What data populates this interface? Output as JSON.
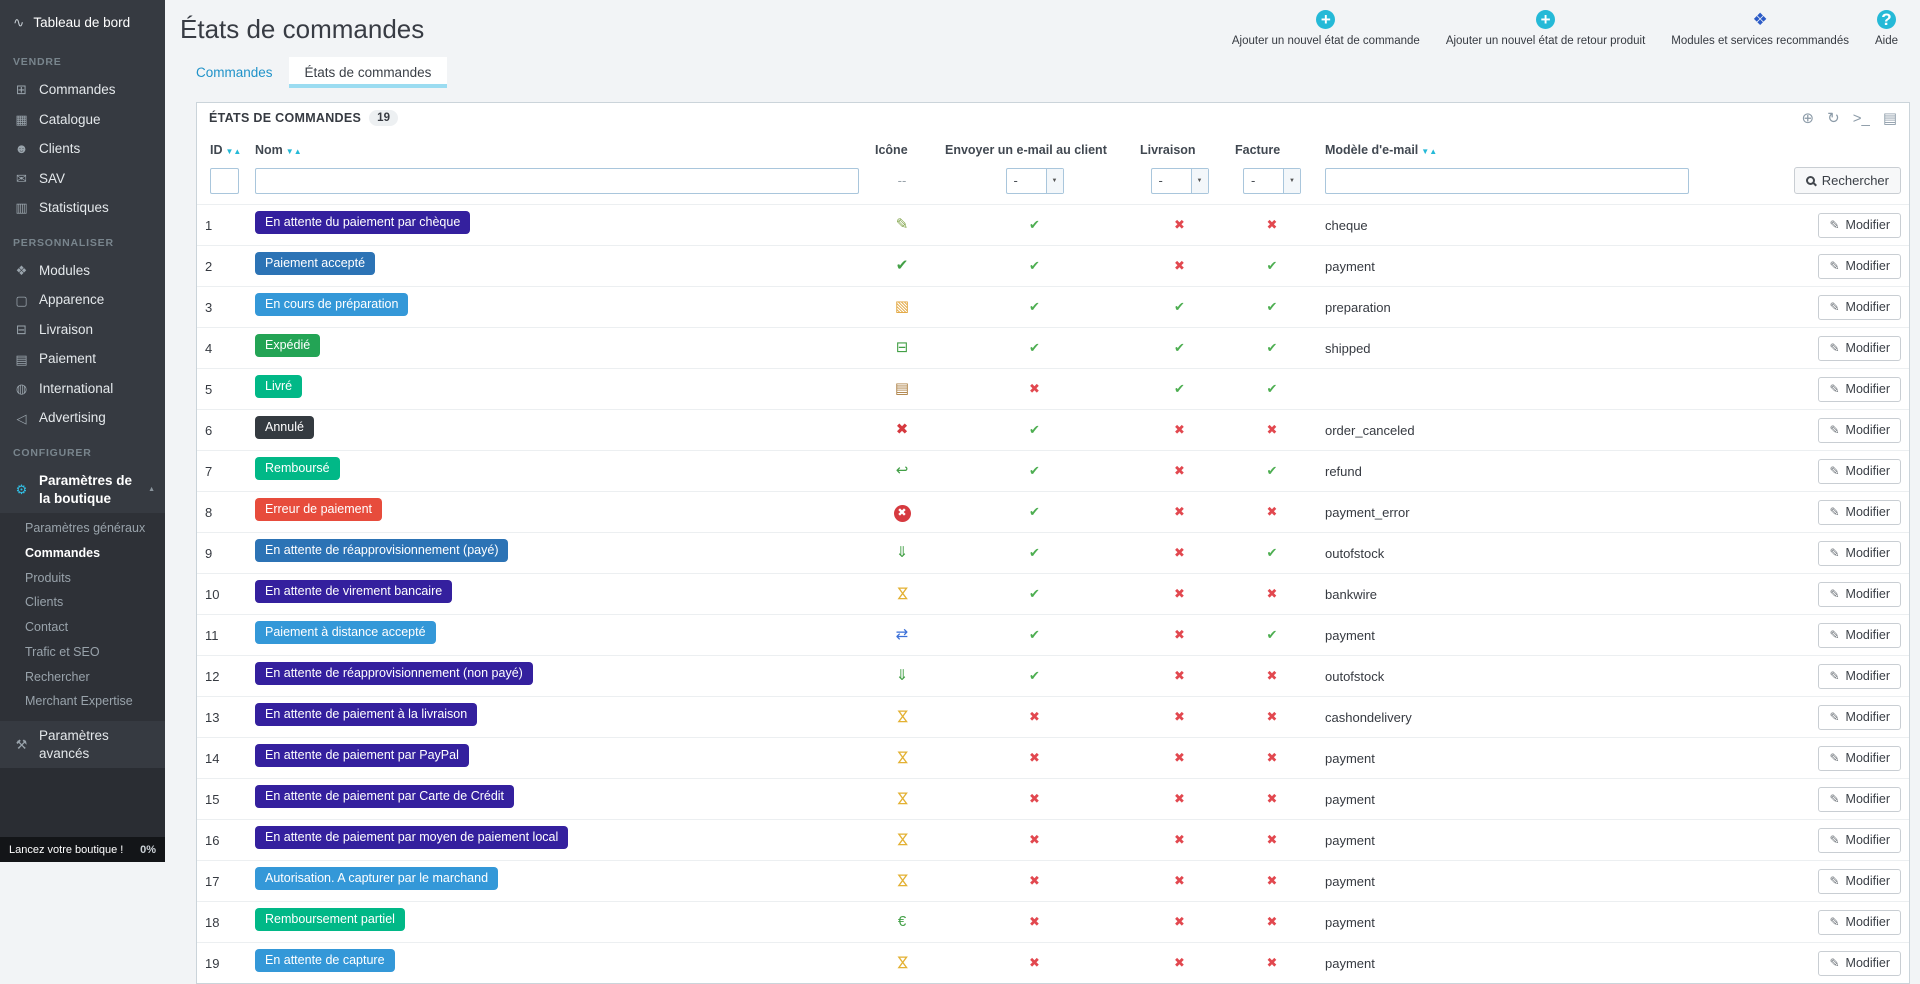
{
  "accent_colors": {
    "primary": "#25B9D7"
  },
  "sidebar": {
    "top_item": {
      "label": "Tableau de bord",
      "icon": "dashboard-icon"
    },
    "sections": [
      {
        "title": "VENDRE",
        "items": [
          {
            "label": "Commandes",
            "icon": "orders-icon"
          },
          {
            "label": "Catalogue",
            "icon": "catalog-icon"
          },
          {
            "label": "Clients",
            "icon": "customers-icon"
          },
          {
            "label": "SAV",
            "icon": "customer-service-icon"
          },
          {
            "label": "Statistiques",
            "icon": "stats-icon"
          }
        ]
      },
      {
        "title": "PERSONNALISER",
        "items": [
          {
            "label": "Modules",
            "icon": "modules-puzzle-icon"
          },
          {
            "label": "Apparence",
            "icon": "appearance-icon"
          },
          {
            "label": "Livraison",
            "icon": "shipping-icon"
          },
          {
            "label": "Paiement",
            "icon": "payment-icon"
          },
          {
            "label": "International",
            "icon": "international-icon"
          },
          {
            "label": "Advertising",
            "icon": "advertising-icon"
          }
        ]
      },
      {
        "title": "CONFIGURER",
        "items": [
          {
            "label": "Paramètres de la boutique",
            "icon": "shop-parameters-icon",
            "active": true,
            "expanded": true,
            "children": [
              {
                "label": "Paramètres généraux"
              },
              {
                "label": "Commandes",
                "active": true
              },
              {
                "label": "Produits"
              },
              {
                "label": "Clients"
              },
              {
                "label": "Contact"
              },
              {
                "label": "Trafic et SEO"
              },
              {
                "label": "Rechercher"
              },
              {
                "label": "Merchant Expertise"
              }
            ]
          },
          {
            "label": "Paramètres avancés",
            "icon": "advanced-parameters-icon"
          }
        ]
      }
    ],
    "footer": {
      "label": "Lancez votre boutique !",
      "progress": "0%"
    }
  },
  "header": {
    "title": "États de commandes",
    "actions": [
      {
        "label": "Ajouter un nouvel état de commande",
        "icon": "plus-circle-icon"
      },
      {
        "label": "Ajouter un nouvel état de retour produit",
        "icon": "plus-circle-icon"
      },
      {
        "label": "Modules et services recommandés",
        "icon": "modules-services-icon"
      },
      {
        "label": "Aide",
        "icon": "help-icon"
      }
    ]
  },
  "tabs": [
    {
      "label": "Commandes",
      "active": false
    },
    {
      "label": "États de commandes",
      "active": true
    }
  ],
  "panel": {
    "title": "ÉTATS DE COMMANDES",
    "count": "19",
    "toolbar": [
      {
        "name": "add-icon"
      },
      {
        "name": "refresh-icon"
      },
      {
        "name": "console-icon"
      },
      {
        "name": "export-icon"
      }
    ]
  },
  "table": {
    "columns": [
      {
        "label": "ID",
        "key": "id",
        "sortable": true,
        "filter": "input"
      },
      {
        "label": "Nom",
        "key": "name",
        "sortable": true,
        "filter": "input"
      },
      {
        "label": "Icône",
        "key": "icon",
        "align": "center",
        "filter": "text"
      },
      {
        "label": "Envoyer un e-mail au client",
        "key": "email",
        "align": "center",
        "filter": "select"
      },
      {
        "label": "Livraison",
        "key": "delivery",
        "align": "center",
        "filter": "select"
      },
      {
        "label": "Facture",
        "key": "invoice",
        "align": "center",
        "filter": "select"
      },
      {
        "label": "Modèle d'e-mail",
        "key": "template",
        "sortable": true,
        "filter": "input"
      },
      {
        "label": "",
        "key": "actions",
        "filter": "search"
      }
    ],
    "filters": {
      "icon_placeholder": "--",
      "select_value": "-",
      "search_button": "Rechercher"
    },
    "edit_label": "Modifier",
    "rows": [
      {
        "id": "1",
        "name": "En attente du paiement par chèque",
        "color": "#34209E",
        "icon": "cheque-icon",
        "email": true,
        "delivery": false,
        "invoice": false,
        "template": "cheque"
      },
      {
        "id": "2",
        "name": "Paiement accepté",
        "color": "#2C73B5",
        "icon": "valid-icon",
        "email": true,
        "delivery": false,
        "invoice": true,
        "template": "payment"
      },
      {
        "id": "3",
        "name": "En cours de préparation",
        "color": "#3498D8",
        "icon": "preparation-icon",
        "email": true,
        "delivery": true,
        "invoice": true,
        "template": "preparation"
      },
      {
        "id": "4",
        "name": "Expédié",
        "color": "#23A455",
        "icon": "truck-icon",
        "email": true,
        "delivery": true,
        "invoice": true,
        "template": "shipped"
      },
      {
        "id": "5",
        "name": "Livré",
        "color": "#01B887",
        "icon": "delivered-icon",
        "email": false,
        "delivery": true,
        "invoice": true,
        "template": ""
      },
      {
        "id": "6",
        "name": "Annulé",
        "color": "#343A40",
        "icon": "canceled-icon",
        "email": true,
        "delivery": false,
        "invoice": false,
        "template": "order_canceled"
      },
      {
        "id": "7",
        "name": "Remboursé",
        "color": "#01B887",
        "icon": "refund-icon",
        "email": true,
        "delivery": false,
        "invoice": true,
        "template": "refund"
      },
      {
        "id": "8",
        "name": "Erreur de paiement",
        "color": "#E74C3C",
        "icon": "payment-error-icon",
        "email": true,
        "delivery": false,
        "invoice": false,
        "template": "payment_error"
      },
      {
        "id": "9",
        "name": "En attente de réapprovisionnement (payé)",
        "color": "#2C73B5",
        "icon": "restock-icon",
        "email": true,
        "delivery": false,
        "invoice": true,
        "template": "outofstock"
      },
      {
        "id": "10",
        "name": "En attente de virement bancaire",
        "color": "#34209E",
        "icon": "waiting-icon",
        "email": true,
        "delivery": false,
        "invoice": false,
        "template": "bankwire"
      },
      {
        "id": "11",
        "name": "Paiement à distance accepté",
        "color": "#3498D8",
        "icon": "remote-payment-icon",
        "email": true,
        "delivery": false,
        "invoice": true,
        "template": "payment"
      },
      {
        "id": "12",
        "name": "En attente de réapprovisionnement (non payé)",
        "color": "#34209E",
        "icon": "restock-icon",
        "email": true,
        "delivery": false,
        "invoice": false,
        "template": "outofstock"
      },
      {
        "id": "13",
        "name": "En attente de paiement à la livraison",
        "color": "#34209E",
        "icon": "waiting-icon",
        "email": false,
        "delivery": false,
        "invoice": false,
        "template": "cashondelivery"
      },
      {
        "id": "14",
        "name": "En attente de paiement par PayPal",
        "color": "#34209E",
        "icon": "waiting-icon",
        "email": false,
        "delivery": false,
        "invoice": false,
        "template": "payment"
      },
      {
        "id": "15",
        "name": "En attente de paiement par Carte de Crédit",
        "color": "#34209E",
        "icon": "waiting-icon",
        "email": false,
        "delivery": false,
        "invoice": false,
        "template": "payment"
      },
      {
        "id": "16",
        "name": "En attente de paiement par moyen de paiement local",
        "color": "#34209E",
        "icon": "waiting-icon",
        "email": false,
        "delivery": false,
        "invoice": false,
        "template": "payment"
      },
      {
        "id": "17",
        "name": "Autorisation. A capturer par le marchand",
        "color": "#3498D8",
        "icon": "waiting-icon",
        "email": false,
        "delivery": false,
        "invoice": false,
        "template": "payment"
      },
      {
        "id": "18",
        "name": "Remboursement partiel",
        "color": "#01B887",
        "icon": "money-icon",
        "email": false,
        "delivery": false,
        "invoice": false,
        "template": "payment"
      },
      {
        "id": "19",
        "name": "En attente de capture",
        "color": "#3498D8",
        "icon": "waiting-icon",
        "email": false,
        "delivery": false,
        "invoice": false,
        "template": "payment"
      }
    ]
  },
  "icon_map": {
    "dashboard-icon": {
      "glyph": "∿",
      "fg": "#C4CBD1"
    },
    "orders-icon": {
      "glyph": "⊞",
      "fg": "#9AA4AC"
    },
    "catalog-icon": {
      "glyph": "▦",
      "fg": "#9AA4AC"
    },
    "customers-icon": {
      "glyph": "☻",
      "fg": "#9AA4AC"
    },
    "customer-service-icon": {
      "glyph": "✉",
      "fg": "#9AA4AC"
    },
    "stats-icon": {
      "glyph": "▥",
      "fg": "#9AA4AC"
    },
    "modules-puzzle-icon": {
      "glyph": "❖",
      "fg": "#9AA4AC"
    },
    "appearance-icon": {
      "glyph": "▢",
      "fg": "#9AA4AC"
    },
    "shipping-icon": {
      "glyph": "⊟",
      "fg": "#9AA4AC"
    },
    "payment-icon": {
      "glyph": "▤",
      "fg": "#9AA4AC"
    },
    "international-icon": {
      "glyph": "◍",
      "fg": "#9AA4AC"
    },
    "advertising-icon": {
      "glyph": "◁",
      "fg": "#9AA4AC"
    },
    "shop-parameters-icon": {
      "glyph": "⚙",
      "fg": "#31C1E7"
    },
    "advanced-parameters-icon": {
      "glyph": "⚒",
      "fg": "#9AA4AC"
    },
    "chevron-up-icon": {
      "glyph": "▲",
      "fg": "#8A949C"
    },
    "chevron-down-icon": {
      "glyph": "▼",
      "fg": "#555555"
    },
    "plus-circle-icon": {
      "glyph": "+",
      "fg": "#FFFFFF",
      "bg": "#25B9D7",
      "shape": "circle"
    },
    "modules-services-icon": {
      "glyph": "❖",
      "fg": "#2C5BC7"
    },
    "help-icon": {
      "glyph": "?",
      "fg": "#FFFFFF",
      "bg": "#25B9D7",
      "shape": "circle"
    },
    "add-icon": {
      "glyph": "⊕",
      "fg": "#8C9BA8"
    },
    "refresh-icon": {
      "glyph": "↻",
      "fg": "#8C9BA8"
    },
    "console-icon": {
      "glyph": ">_",
      "fg": "#8C9BA8"
    },
    "export-icon": {
      "glyph": "▤",
      "fg": "#8C9BA8"
    },
    "search-icon": {
      "css": "magnifier"
    },
    "pencil-icon": {
      "glyph": "✎",
      "fg": "#6B7177"
    },
    "sort-desc-icon": {
      "glyph": "▼",
      "fg": "#25B9D7"
    },
    "sort-asc-icon": {
      "glyph": "▲",
      "fg": "#25B9D7"
    },
    "yes-icon": {
      "glyph": "✔",
      "fg": "#4DAE51"
    },
    "no-icon": {
      "glyph": "✖",
      "fg": "#E2484F"
    },
    "cheque-icon": {
      "glyph": "✎",
      "fg": "#7FA348"
    },
    "valid-icon": {
      "glyph": "✔",
      "fg": "#43A047"
    },
    "preparation-icon": {
      "glyph": "▧",
      "fg": "#E0A030"
    },
    "truck-icon": {
      "glyph": "⊟",
      "fg": "#43A047"
    },
    "delivered-icon": {
      "glyph": "▤",
      "fg": "#A97B3C"
    },
    "canceled-icon": {
      "glyph": "✖",
      "fg": "#D6393F"
    },
    "refund-icon": {
      "glyph": "↩",
      "fg": "#43A047"
    },
    "payment-error-icon": {
      "glyph": "✖",
      "fg": "#FFFFFF",
      "bg": "#D6393F",
      "shape": "circle"
    },
    "restock-icon": {
      "glyph": "⇓",
      "fg": "#43A047"
    },
    "waiting-icon": {
      "glyph": "⋈",
      "fg": "#E3B133",
      "rot": true
    },
    "remote-payment-icon": {
      "glyph": "⇄",
      "fg": "#3A6FD8"
    },
    "money-icon": {
      "glyph": "€",
      "fg": "#43A047"
    }
  }
}
